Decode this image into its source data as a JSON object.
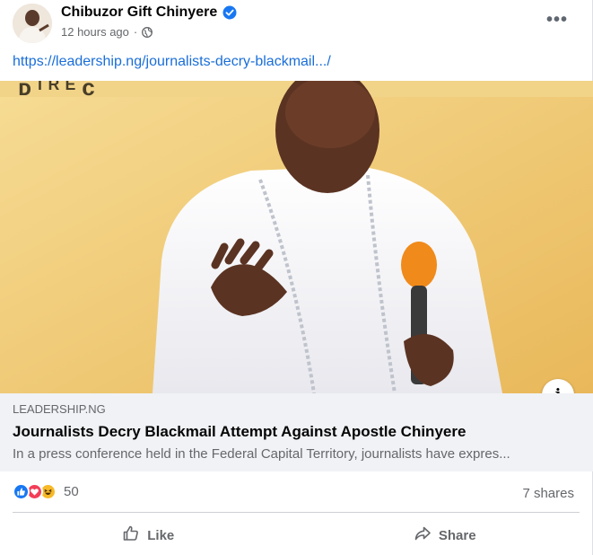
{
  "post": {
    "author": "Chibuzor Gift Chinyere",
    "timestamp": "12 hours ago",
    "separator": "·",
    "audience_icon": "globe-icon",
    "more_label": "•••",
    "link_text": "https://leadership.ng/journalists-decry-blackmail.../"
  },
  "preview": {
    "domain": "LEADERSHIP.NG",
    "title": "Journalists Decry Blackmail Attempt Against Apostle Chinyere",
    "description": "In a press conference held in the Federal Capital Territory, journalists have expres...",
    "info_label": "i"
  },
  "engagement": {
    "reactions": [
      "like-icon",
      "love-icon",
      "haha-icon"
    ],
    "reaction_count": "50",
    "shares": "7 shares"
  },
  "actions": {
    "like_label": "Like",
    "share_label": "Share"
  },
  "colors": {
    "link": "#1a6ed8",
    "verified": "#1877f2",
    "secondary_text": "#65676b",
    "preview_bg": "#f0f2f5"
  }
}
